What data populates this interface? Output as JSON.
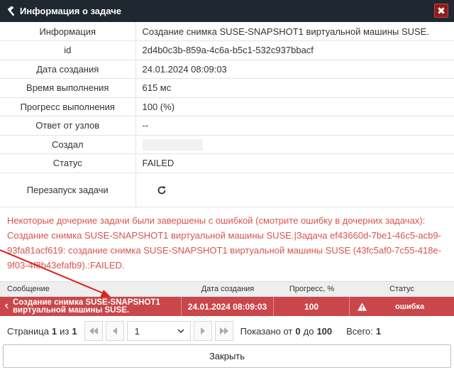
{
  "window": {
    "title": "Информация о задаче",
    "close_glyph": "✖"
  },
  "info": {
    "rows": [
      {
        "key": "Информация",
        "value": "Создание снимка SUSE-SNAPSHOT1 виртуальной машины SUSE."
      },
      {
        "key": "id",
        "value": "2d4b0c3b-859a-4c6a-b5c1-532c937bbacf"
      },
      {
        "key": "Дата создания",
        "value": "24.01.2024 08:09:03"
      },
      {
        "key": "Время выполнения",
        "value": "615 мс"
      },
      {
        "key": "Прогресс выполнения",
        "value": "100 (%)"
      },
      {
        "key": "Ответ от узлов",
        "value": "--"
      },
      {
        "key": "Создал",
        "value": ""
      },
      {
        "key": "Статус",
        "value": "FAILED"
      },
      {
        "key": "Перезапуск задачи",
        "value": ""
      }
    ]
  },
  "error_text": "Некоторые дочерние задачи были завершены с ошибкой (смотрите ошибку в дочерних задачах): Создание снимка SUSE-SNAPSHOT1 виртуальной машины SUSE.|Задача ef43660d-7be1-46c5-acb9-93fa81acf619: создание снимка SUSE-SNAPSHOT1 виртуальной машины SUSE (43fc5af0-7c55-418e-9f03-4f8b43efafb9).:FAILED.",
  "grid": {
    "headers": {
      "message": "Сообщение",
      "created": "Дата создания",
      "progress": "Прогресс, %",
      "status": "Статус"
    },
    "row": {
      "message": "Создание снимка SUSE-SNAPSHOT1 виртуальной машины SUSE.",
      "created": "24.01.2024 08:09:03",
      "progress": "100",
      "status": "ошибка"
    }
  },
  "pager": {
    "page_label": "Страница",
    "page_current": "1",
    "page_of": "из",
    "page_total": "1",
    "page_select_value": "1",
    "shown_label": "Показано от",
    "shown_from": "0",
    "shown_to_label": "до",
    "shown_to": "100",
    "total_label": "Всего:",
    "total": "1"
  },
  "footer": {
    "close_label": "Закрыть"
  },
  "colors": {
    "titlebar": "#1f2730",
    "error_row": "#c9474a",
    "error_text": "#d9534f",
    "annotation_arrow": "#e02020"
  },
  "icons": [
    "hammer-icon",
    "close-icon",
    "restart-icon",
    "warning-icon",
    "first-page-icon",
    "prev-page-icon",
    "next-page-icon",
    "last-page-icon",
    "chevron-down-icon"
  ]
}
